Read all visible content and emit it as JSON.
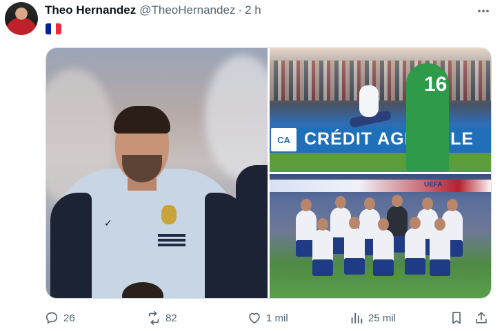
{
  "post": {
    "author_name": "Theo Hernandez",
    "author_handle": "@TheoHernandez",
    "separator": "·",
    "time": "2 h",
    "flag_colors": [
      "#002395",
      "#ffffff",
      "#ed2939"
    ]
  },
  "media": {
    "images": [
      {
        "alt": "player-portrait"
      },
      {
        "alt": "match-action",
        "board_logo": "CA",
        "board_text": "CRÉDIT AGRICOLE",
        "jersey_number": "16"
      },
      {
        "alt": "team-photo",
        "banner_text": "UEFA"
      }
    ]
  },
  "actions": {
    "replies": "26",
    "reposts": "82",
    "likes": "1 mil",
    "views": "25 mil"
  },
  "colors": {
    "text_primary": "#0f1419",
    "text_secondary": "#536471",
    "border": "#cfd9de"
  }
}
